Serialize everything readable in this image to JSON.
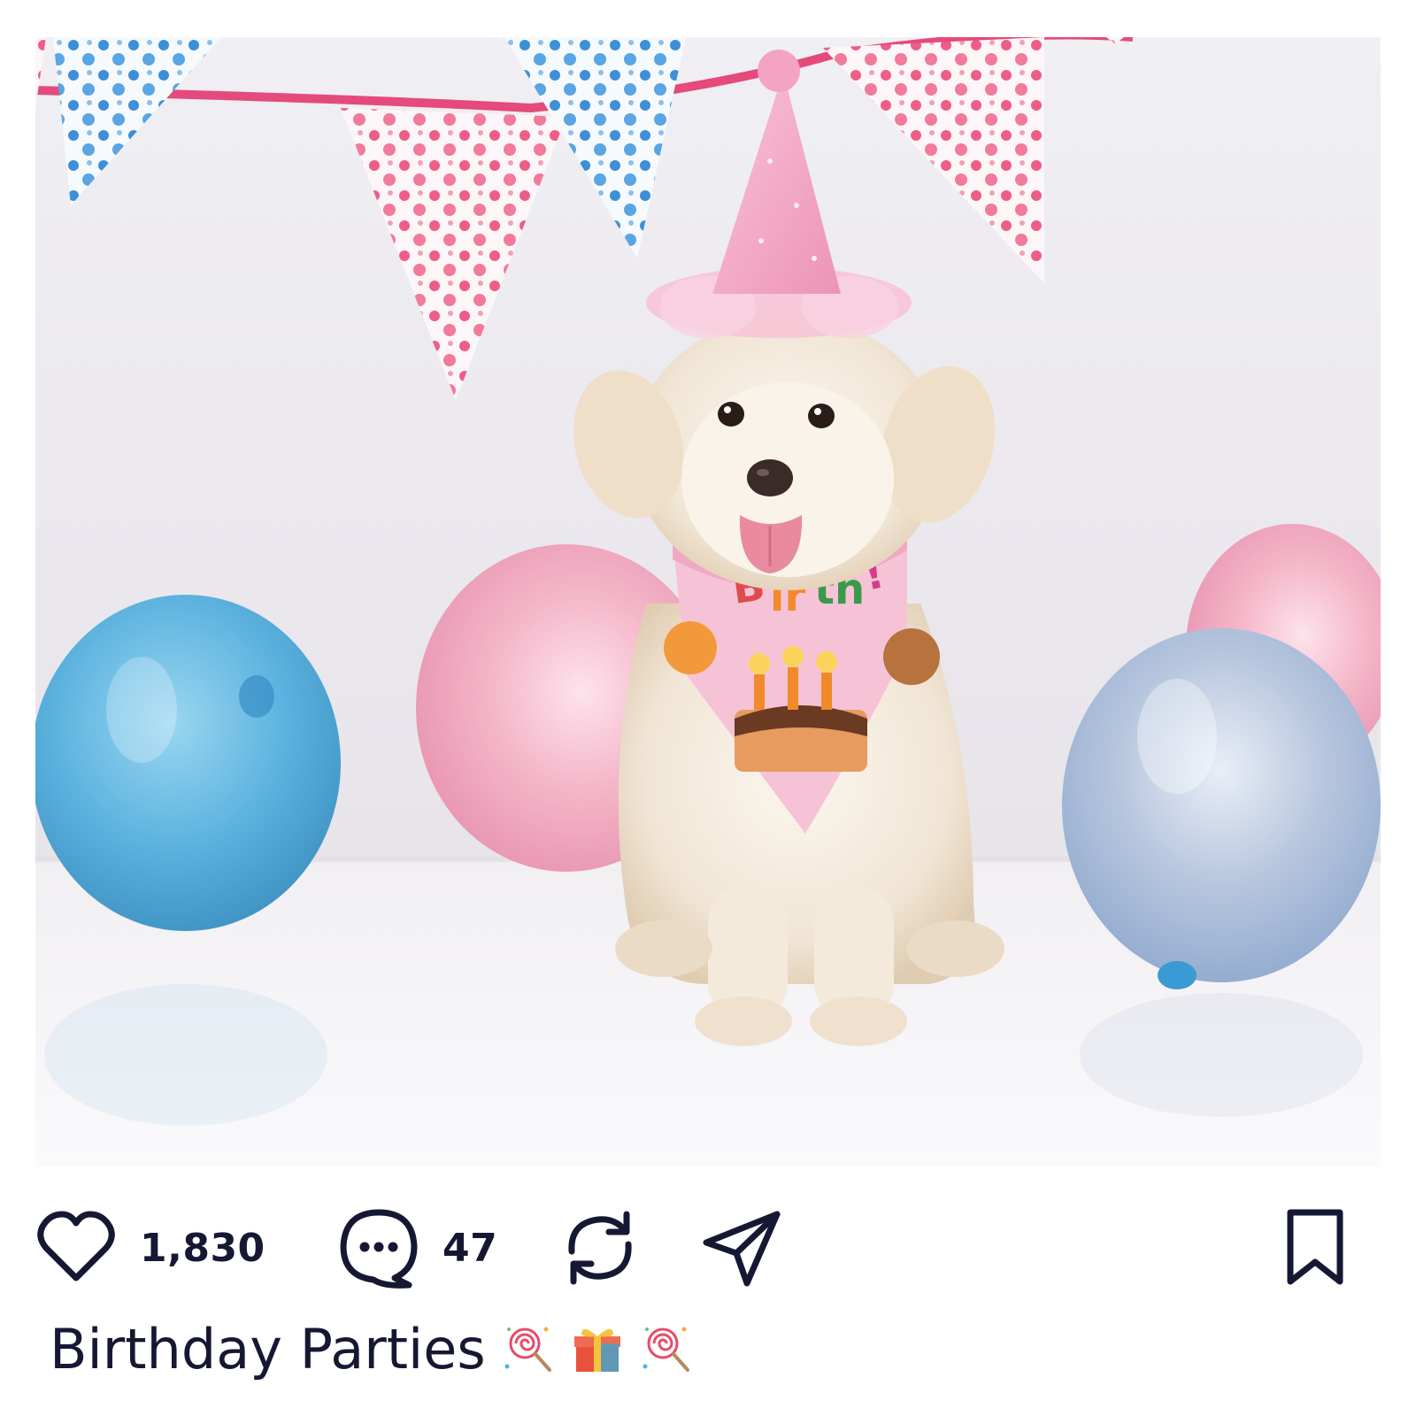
{
  "post": {
    "image": {
      "subject": "white puppy wearing pink glitter party hat and pink birthday bandana",
      "bandana_text": "Birthday!"
    },
    "actions": {
      "like": {
        "icon": "heart-icon",
        "count": "1,830"
      },
      "comment": {
        "icon": "comment-bubble-icon",
        "count": "47"
      },
      "repost": {
        "icon": "repost-icon"
      },
      "share": {
        "icon": "paper-plane-icon"
      },
      "save": {
        "icon": "bookmark-icon"
      }
    },
    "caption": {
      "text": "Birthday Parties",
      "emojis": [
        "lollipop-icon",
        "gift-icon",
        "lollipop-icon"
      ]
    }
  },
  "colors": {
    "text": "#161833",
    "pink_balloon": "#f2b3c6",
    "blue_balloon": "#5fb3dd",
    "hat_pink": "#f4a6c4"
  }
}
